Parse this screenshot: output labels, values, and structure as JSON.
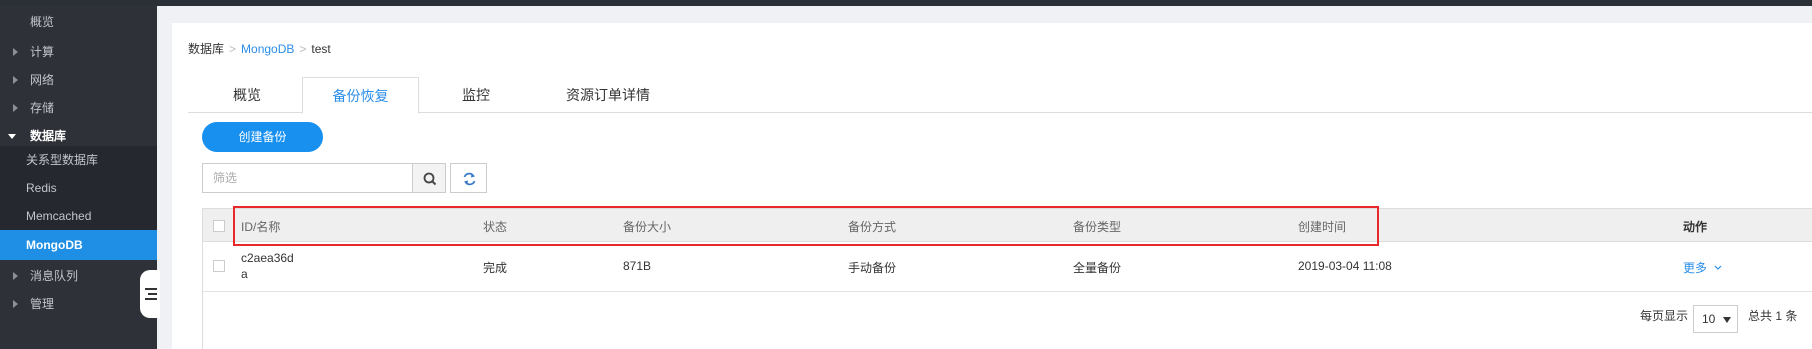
{
  "sidebar": {
    "items": [
      {
        "label": "概览"
      },
      {
        "label": "计算"
      },
      {
        "label": "网络"
      },
      {
        "label": "存储"
      },
      {
        "label": "数据库"
      },
      {
        "label": "关系型数据库"
      },
      {
        "label": "Redis"
      },
      {
        "label": "Memcached"
      },
      {
        "label": "MongoDB"
      },
      {
        "label": "消息队列"
      },
      {
        "label": "管理"
      }
    ]
  },
  "breadcrumb": {
    "root": "数据库",
    "section": "MongoDB",
    "current": "test",
    "sep": ">"
  },
  "tabs": [
    {
      "label": "概览"
    },
    {
      "label": "备份恢复"
    },
    {
      "label": "监控"
    },
    {
      "label": "资源订单详情"
    }
  ],
  "actions": {
    "create_label": "创建备份",
    "filter_placeholder": "筛选"
  },
  "table": {
    "headers": {
      "id": "ID/名称",
      "status": "状态",
      "size": "备份大小",
      "method": "备份方式",
      "type": "备份类型",
      "created": "创建时间",
      "action": "动作"
    },
    "rows": [
      {
        "id_line1": "c2aea36d",
        "id_line2": "a",
        "status": "完成",
        "size": "871B",
        "method": "手动备份",
        "type": "全量备份",
        "created": "2019-03-04 11:08",
        "action": "更多"
      }
    ]
  },
  "pager": {
    "per_page_label": "每页显示",
    "per_page_value": "10",
    "total_label": "总共 1 条"
  },
  "colors": {
    "accent": "#1890f0",
    "highlight": "#e8282b",
    "sidebar": "#2e3138"
  }
}
